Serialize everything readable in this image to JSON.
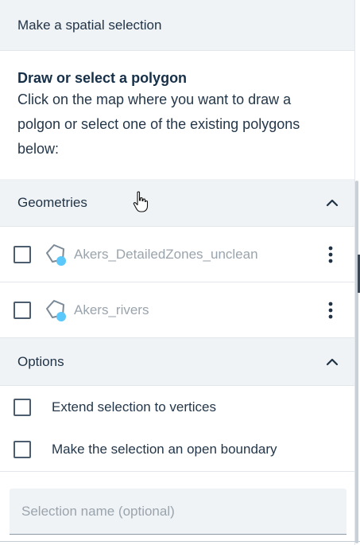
{
  "header": {
    "title": "Make a spatial selection"
  },
  "intro": {
    "title": "Draw or select a polygon",
    "text": "Click on the map where you want to draw a polgon or select one of the existing polygons below:"
  },
  "geometries": {
    "title": "Geometries",
    "items": [
      {
        "label": "Akers_DetailedZones_unclean",
        "checked": false
      },
      {
        "label": "Akers_rivers",
        "checked": false
      }
    ]
  },
  "options": {
    "title": "Options",
    "items": [
      {
        "label": "Extend selection to vertices",
        "checked": false
      },
      {
        "label": "Make the selection an open boundary",
        "checked": false
      }
    ]
  },
  "selection_name": {
    "placeholder": "Selection name (optional)",
    "value": ""
  },
  "colors": {
    "header_bg": "#f0f3f6",
    "title_text": "#163049",
    "muted_text": "#9aa4ad",
    "polygon_stroke": "#7b8a96",
    "polygon_dot": "#5ac8fa"
  },
  "icons": {
    "section_toggle": "chevron-up-icon",
    "row_menu": "more-vertical-icon",
    "geometry": "polygon-icon"
  }
}
